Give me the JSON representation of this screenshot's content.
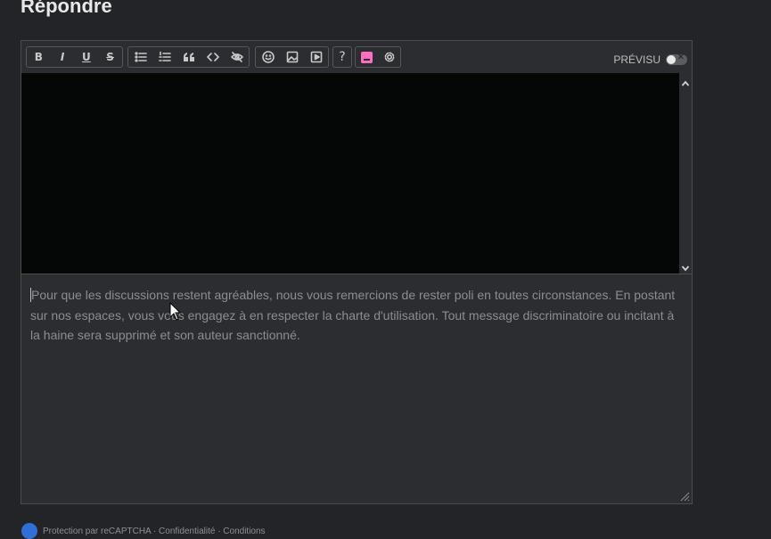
{
  "page": {
    "title": "Répondre"
  },
  "toolbar": {
    "groups": [
      {
        "name": "format",
        "buttons": [
          {
            "id": "bold",
            "label": "B",
            "icon": "bold-icon"
          },
          {
            "id": "italic",
            "label": "I",
            "icon": "italic-icon"
          },
          {
            "id": "underline",
            "label": "U",
            "icon": "underline-icon"
          },
          {
            "id": "strike",
            "label": "S",
            "icon": "strikethrough-icon"
          }
        ]
      },
      {
        "name": "blocks",
        "buttons": [
          {
            "id": "bullet-list",
            "icon": "bullet-list-icon"
          },
          {
            "id": "ordered-list",
            "icon": "ordered-list-icon"
          },
          {
            "id": "quote",
            "icon": "quote-icon"
          },
          {
            "id": "code",
            "icon": "code-icon"
          },
          {
            "id": "spoiler",
            "icon": "eye-off-icon"
          }
        ]
      },
      {
        "name": "media",
        "buttons": [
          {
            "id": "emoji",
            "icon": "smiley-icon"
          },
          {
            "id": "image",
            "icon": "image-icon"
          },
          {
            "id": "video",
            "icon": "video-icon"
          }
        ]
      },
      {
        "name": "help",
        "buttons": [
          {
            "id": "help",
            "label": "?",
            "icon": "help-icon"
          }
        ]
      },
      {
        "name": "theme",
        "buttons": [
          {
            "id": "theme-pink",
            "icon": "pink-swatch-icon"
          },
          {
            "id": "settings",
            "icon": "gear-icon"
          }
        ]
      }
    ],
    "preview_label": "PRÉVISU",
    "preview_enabled": false
  },
  "editor": {
    "placeholder": "Pour que les discussions restent agréables, nous vous remercions de rester poli en toutes circonstances. En postant sur nos espaces, vous vous engagez à en respecter la charte d'utilisation. Tout message discriminatoire ou incitant à la haine sera supprimé et son auteur sanctionné."
  },
  "footer": {
    "recaptcha_text": "Protection par reCAPTCHA · Confidentialité · Conditions"
  },
  "colors": {
    "background": "#232427",
    "editor_bg": "#2b2d31",
    "preview_bg": "#050606",
    "pink_swatch": "#ff6fc0"
  }
}
